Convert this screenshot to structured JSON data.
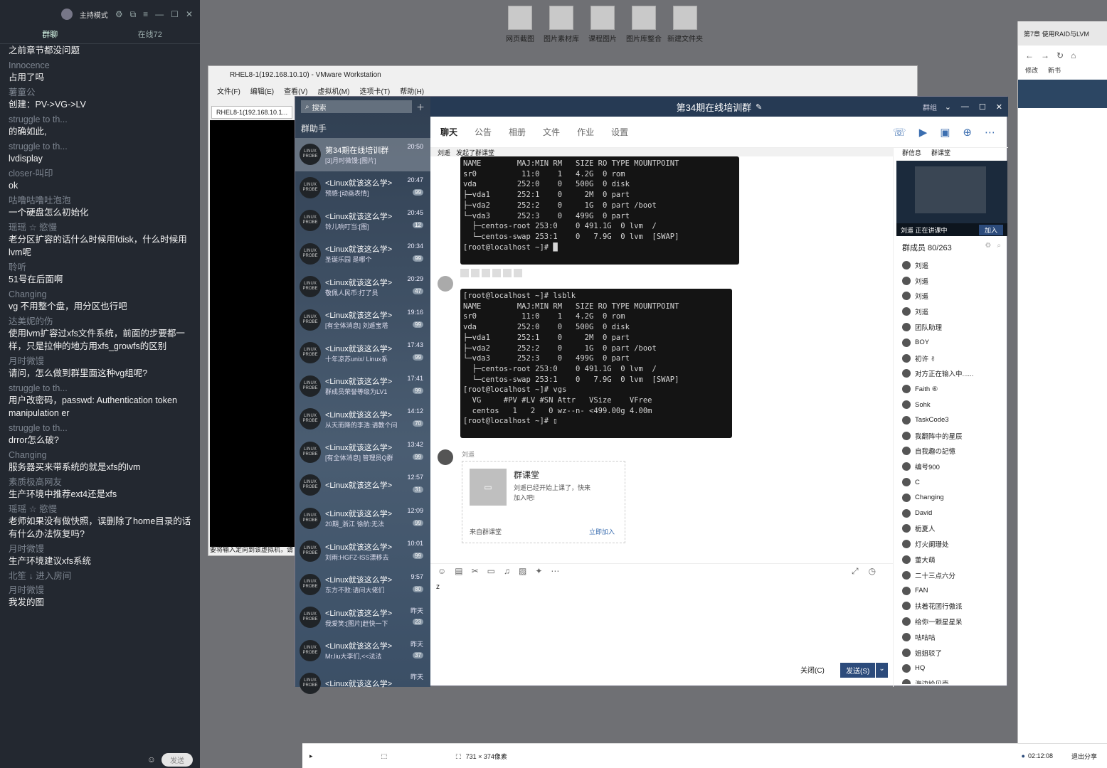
{
  "live": {
    "mode": "主持模式",
    "tab1": "群聊",
    "tab2": "在线72",
    "send": "发送",
    "messages": [
      {
        "n": "",
        "t": "之前章节都没问题"
      },
      {
        "n": "Innocence",
        "t": "占用了吗"
      },
      {
        "n": "薯童公",
        "t": "创建：PV->VG->LV"
      },
      {
        "n": "struggle to th...",
        "t": "的确如此,"
      },
      {
        "n": "struggle to th...",
        "t": "lvdisplay"
      },
      {
        "n": "closer-叫印",
        "t": "ok"
      },
      {
        "n": "咕噜咕噜吐泡泡",
        "t": "一个硬盘怎么初始化"
      },
      {
        "n": "瑶瑶 ☆ 慾慢",
        "t": "老分区扩容的话什么时候用fdisk，什么时候用lvm呢"
      },
      {
        "n": "聆听",
        "t": "51号在后面啊"
      },
      {
        "n": "Changing",
        "t": "vg 不用整个盘，用分区也行吧"
      },
      {
        "n": "达美妮的伤",
        "t": "使用lvm扩容过xfs文件系统，前面的步要都一样，只是拉伸的地方用xfs_growfs的区别"
      },
      {
        "n": "月时微馒",
        "t": "请问，怎么做到群里面这种vg组呢?"
      },
      {
        "n": "struggle to th...",
        "t": "用户改密码，passwd: Authentication token manipulation er"
      },
      {
        "n": "struggle to th...",
        "t": "drror怎么破?"
      },
      {
        "n": "Changing",
        "t": "服务器买来带系统的就是xfs的lvm"
      },
      {
        "n": "素质极高网友",
        "t": "生产环境中推荐ext4还是xfs"
      },
      {
        "n": "瑶瑶 ☆ 慾慢",
        "t": "老师如果没有做快照，误删除了home目录的话有什么办法恢复吗?"
      },
      {
        "n": "月时微馒",
        "t": "生产环境建议xfs系统"
      },
      {
        "n": "北笙 ↓ 进入房间",
        "t": ""
      },
      {
        "n": "月时微馒",
        "t": "我发的图"
      }
    ]
  },
  "desktop": [
    "网页截图",
    "图片素材库",
    "课程图片",
    "图片库整合",
    "新建文件夹"
  ],
  "vm": {
    "title": "RHEL8-1(192.168.10.10) - VMware Workstation",
    "tab": "RHEL8-1(192.168.10.1...",
    "menu": [
      "文件(F)",
      "编辑(E)",
      "查看(V)",
      "虚拟机(M)",
      "选项卡(T)",
      "帮助(H)"
    ],
    "status": "要将输入定向到该虚拟机，请"
  },
  "browser": {
    "tab": "第7章 使用RAID与LVM",
    "fav1": "修改",
    "fav2": "新书"
  },
  "qq": {
    "search": "搜索",
    "helper": "群助手",
    "groups": [
      {
        "name": "第34期在线培训群",
        "preview": "[3]月时微馒:[图片]",
        "time": "20:50",
        "badge": ""
      },
      {
        "name": "<Linux就该这么学>",
        "preview": "预感:[动画表情]",
        "time": "20:47",
        "badge": "99"
      },
      {
        "name": "<Linux就该这么学>",
        "preview": "铃儿响叮当:[图]",
        "time": "20:45",
        "badge": "12"
      },
      {
        "name": "<Linux就该这么学>",
        "preview": "圣诞乐园 是哪个",
        "time": "20:34",
        "badge": "99"
      },
      {
        "name": "<Linux就该这么学>",
        "preview": "敬佩人民币:打了员",
        "time": "20:29",
        "badge": "47"
      },
      {
        "name": "<Linux就该这么学>",
        "preview": "[有全体消息] 刘遥宝塔",
        "time": "19:16",
        "badge": "99"
      },
      {
        "name": "<Linux就该这么学>",
        "preview": "十年凉苏unix/ Linux系",
        "time": "17:43",
        "badge": "99"
      },
      {
        "name": "<Linux就该这么学>",
        "preview": "群成员荣誉等级为LV1",
        "time": "17:41",
        "badge": "99"
      },
      {
        "name": "<Linux就该这么学>",
        "preview": "从天而降的李浩:请教个问",
        "time": "14:12",
        "badge": "70"
      },
      {
        "name": "<Linux就该这么学>",
        "preview": "[有全体消息] 管理员Q群",
        "time": "13:42",
        "badge": "99"
      },
      {
        "name": "<Linux就该这么学>",
        "preview": "",
        "time": "12:57",
        "badge": "31"
      },
      {
        "name": "<Linux就该这么学>",
        "preview": "20期_浙江 徐航:无法",
        "time": "12:09",
        "badge": "99"
      },
      {
        "name": "<Linux就该这么学>",
        "preview": "刘雨:HGFZ-ISS漂移去",
        "time": "10:01",
        "badge": "99"
      },
      {
        "name": "<Linux就该这么学>",
        "preview": "东方不败:请问大佬们",
        "time": "9:57",
        "badge": "80"
      },
      {
        "name": "<Linux就该这么学>",
        "preview": "我爱笑:[图片]赶快一下",
        "time": "昨天",
        "badge": "23"
      },
      {
        "name": "<Linux就该这么学>",
        "preview": "Mr.liu大李们,<<法法",
        "time": "昨天",
        "badge": "37"
      },
      {
        "name": "<Linux就该这么学>",
        "preview": "",
        "time": "昨天",
        "badge": ""
      }
    ],
    "title": "第34期在线培训群",
    "edit": "✎",
    "head_right": "群组",
    "tabs": [
      "聊天",
      "公告",
      "相册",
      "文件",
      "作业",
      "设置"
    ],
    "banner": {
      "who": "刘遥",
      "text": "发起了群课堂"
    },
    "term1": "NAME        MAJ:MIN RM   SIZE RO TYPE MOUNTPOINT\nsr0          11:0    1   4.2G  0 rom\nvda         252:0    0   500G  0 disk\n├─vda1      252:1    0     2M  0 part\n├─vda2      252:2    0     1G  0 part /boot\n└─vda3      252:3    0   499G  0 part\n  ├─centos-root 253:0    0 491.1G  0 lvm  /\n  └─centos-swap 253:1    0   7.9G  0 lvm  [SWAP]\n[root@localhost ~]# █",
    "term2": "[root@localhost ~]# lsblk\nNAME        MAJ:MIN RM   SIZE RO TYPE MOUNTPOINT\nsr0          11:0    1   4.2G  0 rom\nvda         252:0    0   500G  0 disk\n├─vda1      252:1    0     2M  0 part\n├─vda2      252:2    0     1G  0 part /boot\n└─vda3      252:3    0   499G  0 part\n  ├─centos-root 253:0    0 491.1G  0 lvm  /\n  └─centos-swap 253:1    0   7.9G  0 lvm  [SWAP]\n[root@localhost ~]# vgs\n  VG     #PV #LV #SN Attr   VSize    VFree\n  centos   1   2   0 wz--n- <499.00g 4.00m\n[root@localhost ~]# ▯",
    "card": {
      "sender": "刘遥",
      "title": "群课堂",
      "desc": "刘遥已经开始上课了，快来加入吧!",
      "from": "来自群课堂",
      "join": "立即加入"
    },
    "input": "z",
    "close": "关闭(C)",
    "send": "发送(S)",
    "side": {
      "t1": "群信息",
      "t2": "群课堂",
      "live": "刘遥 正在讲课中",
      "join": "加入",
      "members_label": "群成员 80/263"
    },
    "members": [
      "刘遥",
      "刘遥",
      "刘遥",
      "刘遥",
      "团队助理",
      "BOY",
      "初许 ✌",
      "对方正在输入中......",
      "Faith ⑥",
      "Sohk",
      "TaskCode3",
      "我翻阵中的星辰",
      "自我趣の記憶",
      "编号900",
      "C",
      "Changing",
      "David",
      "栀夏人",
      "灯火阑珊处",
      "董大萌",
      "二十三点六分",
      "FAN",
      "扶着花团行傲派",
      "给你一颗星星呆",
      "咕咕咕",
      "姐姐驳了",
      "HQ",
      "海边捡贝壳"
    ]
  },
  "taskbar": {
    "size": "731 × 374像素",
    "time": "02:12:08",
    "exit": "退出分享"
  }
}
